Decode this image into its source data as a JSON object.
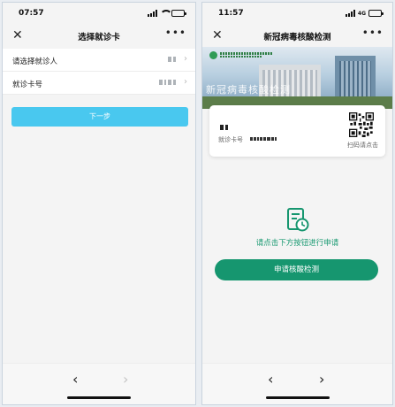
{
  "left": {
    "status": {
      "time": "07:57"
    },
    "nav": {
      "close": "✕",
      "title": "选择就诊卡",
      "more": "•••"
    },
    "rows": [
      {
        "label": "请选择就诊人",
        "chevron": "›"
      },
      {
        "label": "就诊卡号",
        "chevron": "›"
      }
    ],
    "next_label": "下一步",
    "bottom": {
      "back": "‹",
      "forward": "›"
    }
  },
  "right": {
    "status": {
      "time": "11:57",
      "network": "4G"
    },
    "nav": {
      "close": "✕",
      "title": "新冠病毒核酸检测",
      "more": "•••"
    },
    "banner_watermark": "新冠病毒核酸检测",
    "card": {
      "cardno_label": "就诊卡号",
      "scan_label": "扫码请点击"
    },
    "hint": "请点击下方按钮进行申请",
    "apply_label": "申请核酸检测",
    "bottom": {
      "back": "‹",
      "forward": "›"
    }
  },
  "colors": {
    "accent_blue": "#49c8ef",
    "accent_green": "#16966f",
    "hint_green": "#1a9a72"
  },
  "icons": [
    "close-icon",
    "more-icon",
    "chevron-right-icon",
    "back-arrow-icon",
    "forward-arrow-icon",
    "qr-code-icon",
    "document-clock-icon"
  ]
}
